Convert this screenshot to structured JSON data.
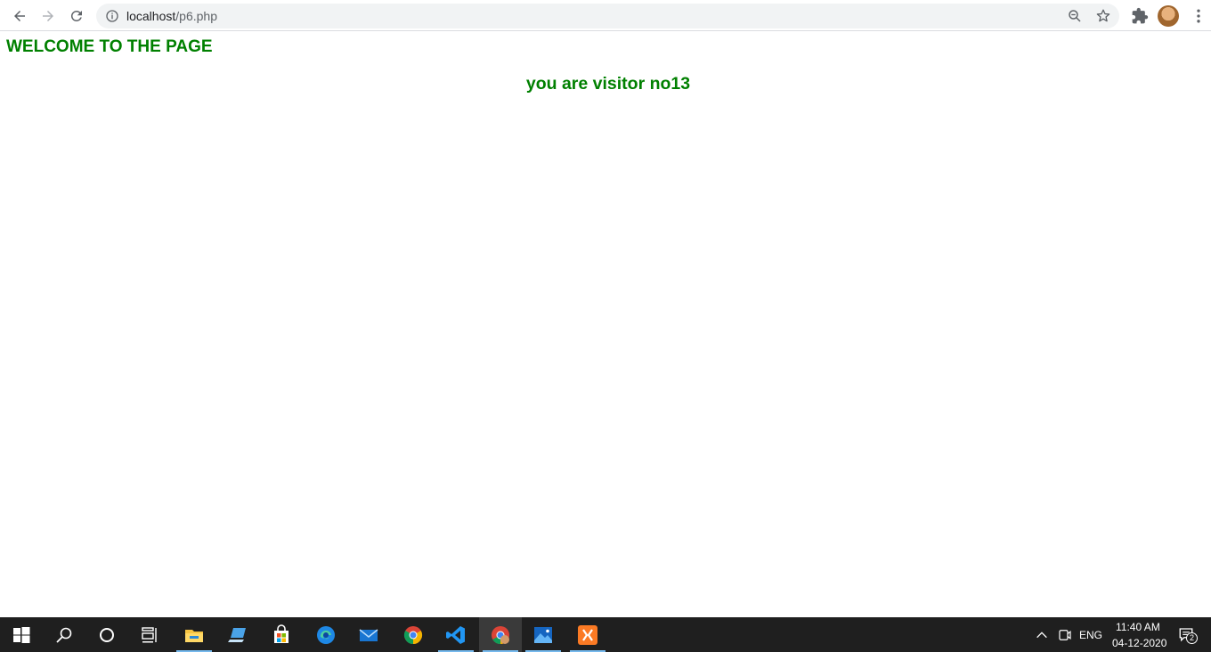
{
  "browser": {
    "url_host": "localhost",
    "url_path": "/p6.php"
  },
  "page": {
    "heading": "WELCOME TO THE PAGE",
    "visitor_text": "you are visitor no13"
  },
  "colors": {
    "text_green": "#008000",
    "taskbar_bg": "#1f1f1f",
    "active_underline": "#76b9ed"
  },
  "taskbar": {
    "apps": [
      "start",
      "search",
      "cortana",
      "task-view",
      "file-explorer",
      "laptop-app",
      "microsoft-store",
      "edge",
      "mail",
      "chrome",
      "vscode",
      "chrome-profile",
      "photos",
      "xampp"
    ],
    "tray": {
      "language": "ENG",
      "time": "11:40 AM",
      "date": "04-12-2020",
      "notification_count": "2"
    }
  }
}
